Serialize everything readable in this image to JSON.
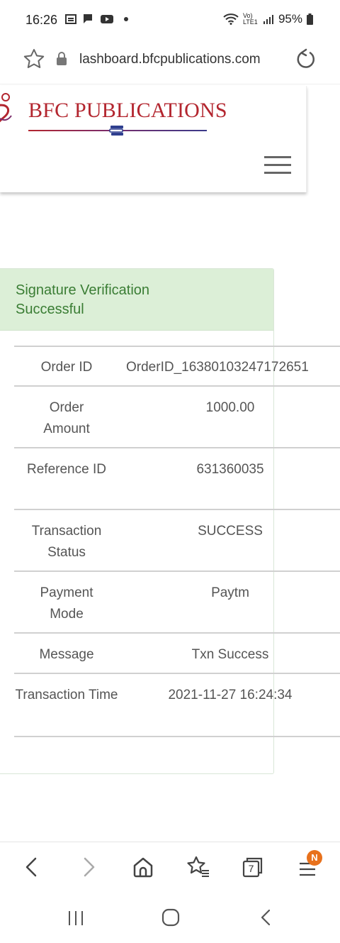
{
  "status_bar": {
    "time": "16:26",
    "network": "Vo) LTE1",
    "battery": "95%"
  },
  "browser": {
    "url": "lashboard.bfcpublications.com",
    "tab_count": "7",
    "menu_badge": "N"
  },
  "site": {
    "brand_name": "BFC PUBLICATIONS"
  },
  "alert": {
    "line1": "Signature Verification",
    "line2": "Successful"
  },
  "details": [
    {
      "label": "Order ID",
      "value": "OrderID_16380103247172651"
    },
    {
      "label": "Order Amount",
      "value": "1000.00"
    },
    {
      "label": "Reference ID",
      "value": "631360035"
    },
    {
      "label": "Transaction Status",
      "value": "SUCCESS"
    },
    {
      "label": "Payment Mode",
      "value": "Paytm"
    },
    {
      "label": "Message",
      "value": "Txn Success"
    },
    {
      "label": "Transaction Time",
      "value": "2021-11-27 16:24:34"
    }
  ],
  "colors": {
    "brand": "#b3262f",
    "alert_bg": "#dcefd7",
    "alert_text": "#3a7d34",
    "badge": "#e8711c"
  }
}
